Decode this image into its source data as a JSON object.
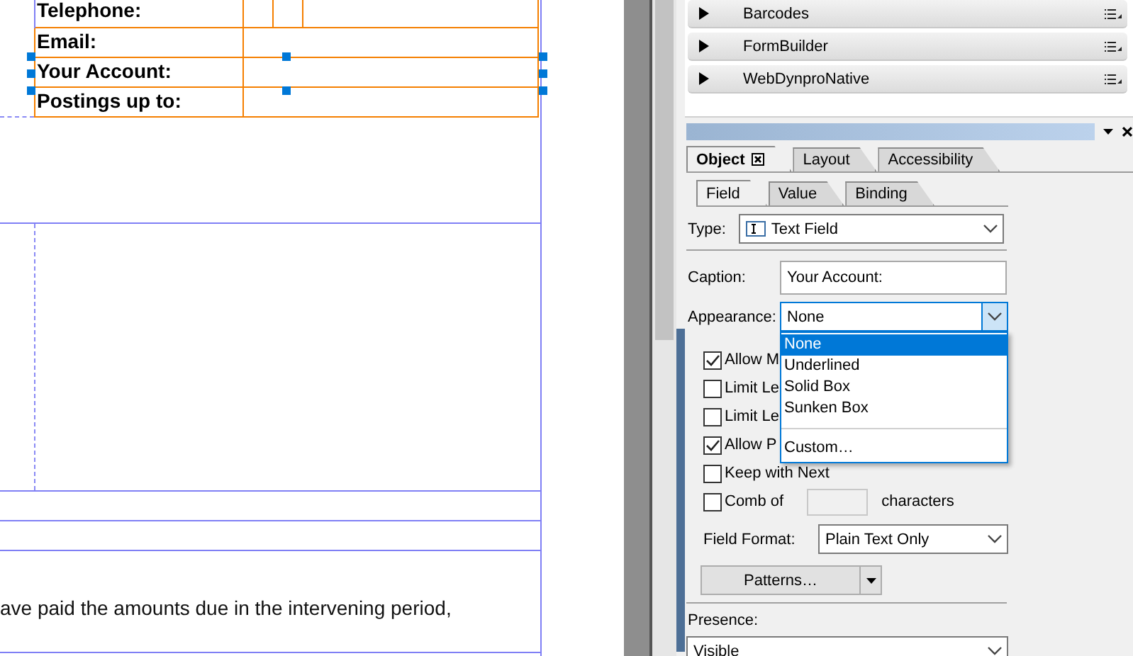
{
  "canvas": {
    "fields": [
      {
        "label": "Telephone:",
        "selected": false
      },
      {
        "label": "Email:",
        "selected": false
      },
      {
        "label": "Your Account:",
        "selected": true
      },
      {
        "label": "Postings up to:",
        "selected": false
      }
    ],
    "body_text": "ave paid the amounts due in the intervening period,"
  },
  "library": {
    "items": [
      {
        "label": "Barcodes",
        "expanded": false
      },
      {
        "label": "FormBuilder",
        "expanded": false
      },
      {
        "label": "WebDynproNative",
        "expanded": false
      }
    ]
  },
  "palette": {
    "tabs": [
      {
        "label": "Object",
        "selected": true
      },
      {
        "label": "Layout",
        "selected": false
      },
      {
        "label": "Accessibility",
        "selected": false
      }
    ],
    "subtabs": [
      {
        "label": "Field",
        "selected": true
      },
      {
        "label": "Value",
        "selected": false
      },
      {
        "label": "Binding",
        "selected": false
      }
    ],
    "type": {
      "label": "Type:",
      "value": "Text Field"
    },
    "caption": {
      "label": "Caption:",
      "value": "Your Account:"
    },
    "appearance": {
      "label": "Appearance:",
      "value": "None",
      "options": [
        {
          "kind": "option",
          "label": "None",
          "selected": true
        },
        {
          "kind": "option",
          "label": "Underlined",
          "selected": false
        },
        {
          "kind": "option",
          "label": "Solid Box",
          "selected": false
        },
        {
          "kind": "option",
          "label": "Sunken Box",
          "selected": false
        },
        {
          "kind": "separator"
        },
        {
          "kind": "option",
          "label": "Custom…",
          "selected": false
        }
      ]
    },
    "checkboxes": [
      {
        "kind": "check",
        "label": "Allow M",
        "checked": true
      },
      {
        "kind": "check",
        "label": "Limit Le",
        "checked": false
      },
      {
        "kind": "check",
        "label": "Limit Le",
        "checked": false
      },
      {
        "kind": "check",
        "label": "Allow P",
        "checked": true
      },
      {
        "kind": "check",
        "label": "Keep with Next",
        "checked": false
      },
      {
        "kind": "comb",
        "label": "Comb of",
        "checked": false,
        "suffix": "characters"
      }
    ],
    "field_format": {
      "label": "Field Format:",
      "value": "Plain Text Only"
    },
    "patterns_button": "Patterns…",
    "presence": {
      "label": "Presence:",
      "value": "Visible"
    }
  }
}
